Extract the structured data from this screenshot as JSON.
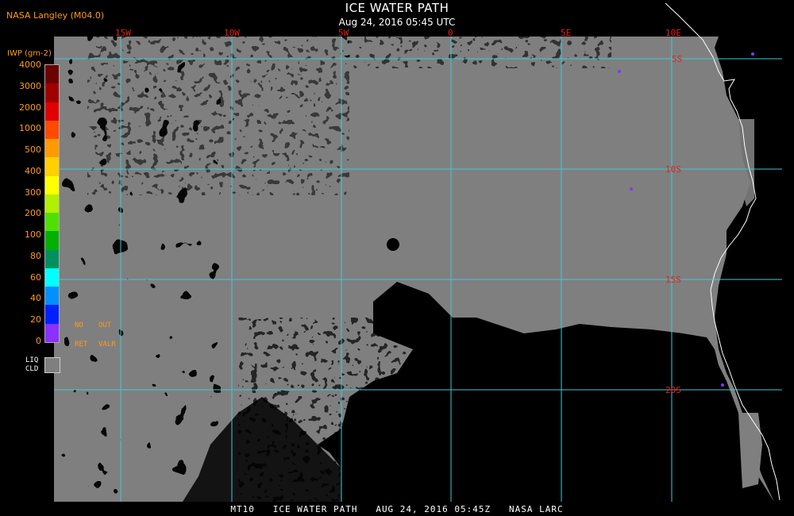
{
  "header": {
    "credit": "NASA Langley (M04.0)",
    "title": "ICE WATER PATH",
    "subtitle": "Aug 24, 2016 05:45 UTC"
  },
  "map": {
    "longitude_labels": [
      "15W",
      "10W",
      "5W",
      "0",
      "5E",
      "10E"
    ],
    "latitude_labels": [
      "5S",
      "10S",
      "15S",
      "20S"
    ],
    "colors": {
      "cloud_gray": "#7f7f7f",
      "clear_black": "#000000",
      "grid": "#40c8d8",
      "coastline": "#ffffff",
      "label": "#e2231a"
    }
  },
  "legend": {
    "units": "IWP (gm-2)",
    "ticks": [
      "4000",
      "3000",
      "2000",
      "1000",
      "500",
      "400",
      "300",
      "200",
      "100",
      "80",
      "60",
      "40",
      "20",
      "0"
    ],
    "color_steps": [
      "#6b0000",
      "#a00000",
      "#e00000",
      "#ff4a00",
      "#ff9a00",
      "#ffd000",
      "#ffff00",
      "#b0f000",
      "#50e000",
      "#00b000",
      "#009060",
      "#00ffff",
      "#0090ff",
      "#0020ff",
      "#8a30ff"
    ],
    "categories": [
      "NO",
      "OUT",
      "RET",
      "VALR"
    ],
    "liquid_cloud": "LIQ\nCLD"
  },
  "footer": {
    "text": "MT10   ICE WATER PATH   AUG 24, 2016 05:45Z   NASA LARC"
  }
}
